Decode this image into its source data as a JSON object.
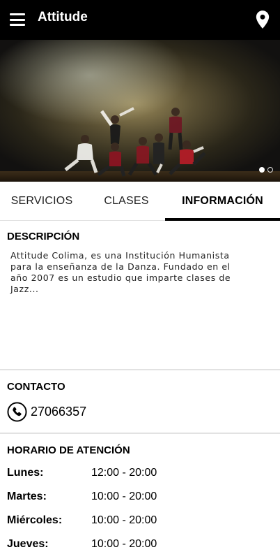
{
  "app": {
    "title": "Attitude"
  },
  "icons": {
    "menu": "menu-icon",
    "location": "location-pin-icon",
    "phone": "phone-icon"
  },
  "hero": {
    "slides": 2,
    "active_slide": 1
  },
  "tabs": [
    {
      "label": "SERVICIOS",
      "active": false
    },
    {
      "label": "CLASES",
      "active": false
    },
    {
      "label": "INFORMACIÓN",
      "active": true
    }
  ],
  "descripcion": {
    "title": "DESCRIPCIÓN",
    "lines": [
      "Attitude Colima, es una Institución Humanista",
      "para la enseñanza de la Danza. Fundado en el",
      "año 2007 es un estudio que imparte clases de",
      "Jazz..."
    ]
  },
  "contacto": {
    "title": "CONTACTO",
    "phone": "27066357"
  },
  "horario": {
    "title": "HORARIO DE ATENCIÓN",
    "days": [
      {
        "day": "Lunes:",
        "hours": "12:00 - 20:00"
      },
      {
        "day": "Martes:",
        "hours": "10:00 - 20:00"
      },
      {
        "day": "Miércoles:",
        "hours": "10:00 - 20:00"
      },
      {
        "day": "Jueves:",
        "hours": "10:00 - 20:00"
      }
    ]
  },
  "colors": {
    "appbar": "#000000",
    "accent": "#000000",
    "divider": "#e2e2e2"
  }
}
